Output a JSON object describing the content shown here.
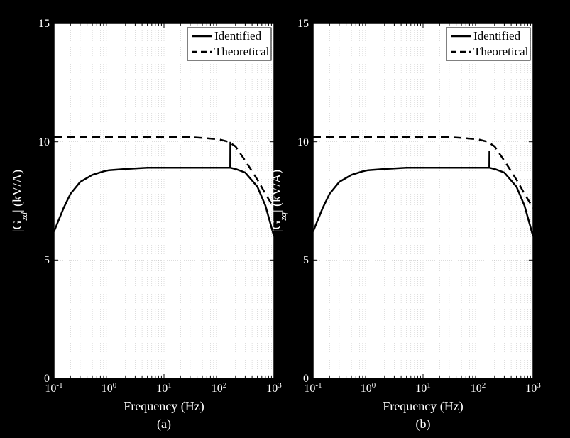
{
  "chart_data": [
    {
      "type": "line",
      "title": "(a)",
      "xlabel": "Frequency (Hz)",
      "ylabel": "|Gzd| (kV/A)",
      "xscale": "log",
      "xlim": [
        0.1,
        1000
      ],
      "ylim": [
        0,
        15
      ],
      "xticks": [
        0.1,
        1,
        10,
        100,
        1000
      ],
      "xtick_labels": [
        "10^{-1}",
        "10^{0}",
        "10^{1}",
        "10^{2}",
        "10^{3}"
      ],
      "yticks": [
        0,
        5,
        10,
        15
      ],
      "series": [
        {
          "name": "Identified",
          "style": "solid",
          "x": [
            0.1,
            0.15,
            0.2,
            0.3,
            0.5,
            0.8,
            1,
            2,
            5,
            10,
            20,
            50,
            80,
            100,
            150,
            160,
            160.5,
            200,
            300,
            500,
            700,
            1000
          ],
          "y": [
            6.2,
            7.2,
            7.8,
            8.3,
            8.6,
            8.75,
            8.8,
            8.85,
            8.9,
            8.9,
            8.9,
            8.9,
            8.9,
            8.9,
            8.9,
            8.9,
            10.0,
            8.85,
            8.7,
            8.1,
            7.3,
            6.0
          ]
        },
        {
          "name": "Theoretical",
          "style": "dashed",
          "x": [
            0.1,
            0.3,
            1,
            3,
            10,
            30,
            60,
            100,
            150,
            200,
            300,
            500,
            700,
            1000
          ],
          "y": [
            10.2,
            10.2,
            10.2,
            10.2,
            10.2,
            10.2,
            10.15,
            10.1,
            10.0,
            9.8,
            9.2,
            8.4,
            7.8,
            7.2
          ]
        }
      ],
      "legend": {
        "position": "upper right"
      }
    },
    {
      "type": "line",
      "title": "(b)",
      "xlabel": "Frequency (Hz)",
      "ylabel": "|Gzq| (kV/A)",
      "xscale": "log",
      "xlim": [
        0.1,
        1000
      ],
      "ylim": [
        0,
        15
      ],
      "xticks": [
        0.1,
        1,
        10,
        100,
        1000
      ],
      "xtick_labels": [
        "10^{-1}",
        "10^{0}",
        "10^{1}",
        "10^{2}",
        "10^{3}"
      ],
      "yticks": [
        0,
        5,
        10,
        15
      ],
      "series": [
        {
          "name": "Identified",
          "style": "solid",
          "x": [
            0.1,
            0.15,
            0.2,
            0.3,
            0.5,
            0.8,
            1,
            2,
            5,
            10,
            20,
            50,
            80,
            100,
            150,
            160,
            160.5,
            200,
            300,
            500,
            700,
            1000
          ],
          "y": [
            6.2,
            7.2,
            7.8,
            8.3,
            8.6,
            8.75,
            8.8,
            8.85,
            8.9,
            8.9,
            8.9,
            8.9,
            8.9,
            8.9,
            8.9,
            8.9,
            9.6,
            8.85,
            8.7,
            8.1,
            7.3,
            6.0
          ]
        },
        {
          "name": "Theoretical",
          "style": "dashed",
          "x": [
            0.1,
            0.3,
            1,
            3,
            10,
            30,
            60,
            100,
            150,
            200,
            300,
            500,
            700,
            1000
          ],
          "y": [
            10.2,
            10.2,
            10.2,
            10.2,
            10.2,
            10.2,
            10.15,
            10.1,
            10.0,
            9.8,
            9.2,
            8.4,
            7.8,
            7.2
          ]
        }
      ],
      "legend": {
        "position": "upper right"
      }
    }
  ],
  "labels": {
    "identified": "Identified",
    "theoretical": "Theoretical",
    "xlabel": "Frequency (Hz)",
    "ylabel_a": "|Gzd| (kV/A)",
    "ylabel_b": "|Gzq| (kV/A)",
    "sub_a": "(a)",
    "sub_b": "(b)"
  }
}
